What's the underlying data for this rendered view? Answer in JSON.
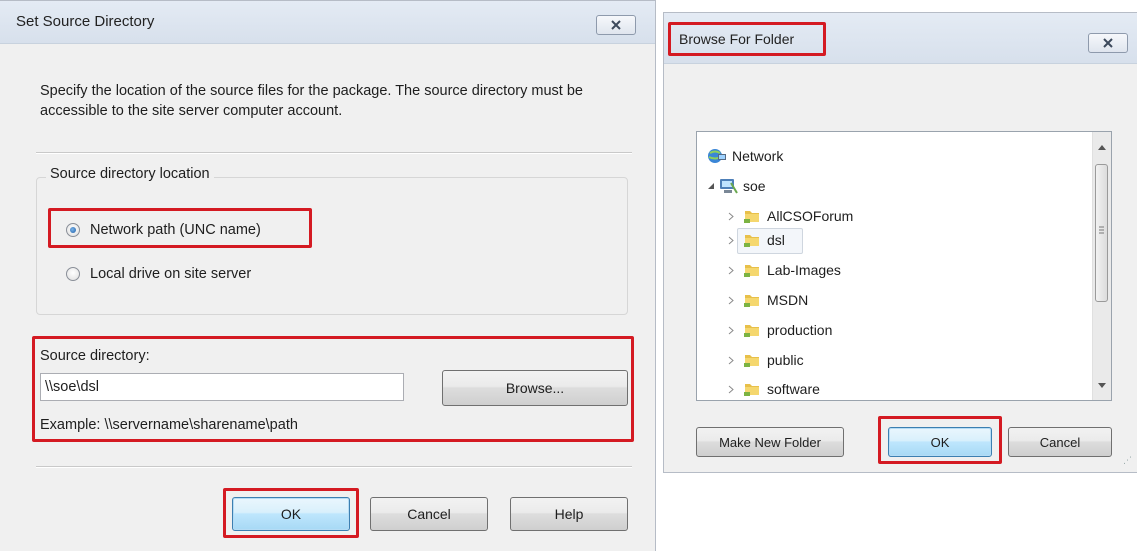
{
  "left_dialog": {
    "title": "Set Source Directory",
    "description": "Specify the location of the source files for the package. The source directory must be accessible to the site server computer account.",
    "group_label": "Source directory location",
    "radio_network": "Network path (UNC name)",
    "radio_local": "Local drive on site server",
    "selected_option": "network",
    "source_label": "Source directory:",
    "source_value": "\\\\soe\\dsl",
    "browse_label": "Browse...",
    "example": "Example: \\\\servername\\sharename\\path",
    "ok_label": "OK",
    "cancel_label": "Cancel",
    "help_label": "Help"
  },
  "right_dialog": {
    "title": "Browse For Folder",
    "tree": {
      "root": "Network",
      "host": "soe",
      "folders": [
        "AllCSOForum",
        "dsl",
        "Lab-Images",
        "MSDN",
        "production",
        "public",
        "software"
      ],
      "selected": "dsl"
    },
    "make_new_folder_label": "Make New Folder",
    "ok_label": "OK",
    "cancel_label": "Cancel"
  },
  "colors": {
    "highlight": "#d41a22",
    "dialog_bg": "#f0f0f0",
    "titlebar": "#dce4ee"
  }
}
